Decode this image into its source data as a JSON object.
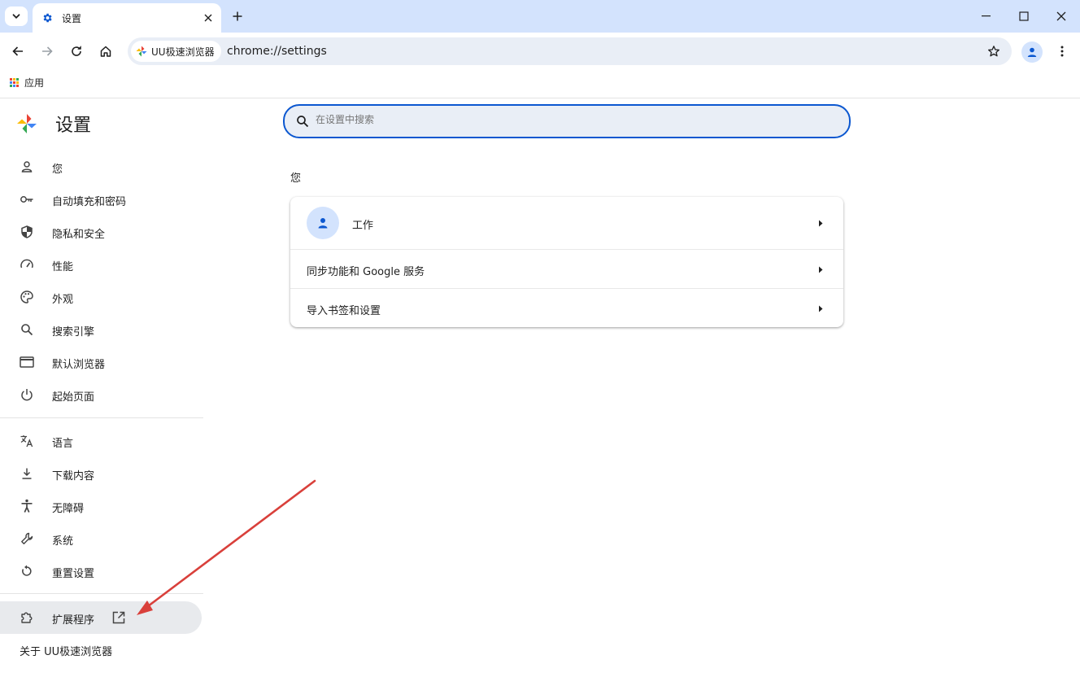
{
  "browser": {
    "tab_title": "设置",
    "chip_label": "UU极速浏览器",
    "url": "chrome://settings",
    "bookmark_apps": "应用"
  },
  "sidebar": {
    "title": "设置",
    "items": [
      {
        "label": "您",
        "icon": "person-icon"
      },
      {
        "label": "自动填充和密码",
        "icon": "key-icon"
      },
      {
        "label": "隐私和安全",
        "icon": "shield-icon"
      },
      {
        "label": "性能",
        "icon": "speedometer-icon"
      },
      {
        "label": "外观",
        "icon": "palette-icon"
      },
      {
        "label": "搜索引擎",
        "icon": "search-icon"
      },
      {
        "label": "默认浏览器",
        "icon": "browser-window-icon"
      },
      {
        "label": "起始页面",
        "icon": "power-icon"
      },
      {
        "label": "语言",
        "icon": "translate-icon"
      },
      {
        "label": "下载内容",
        "icon": "download-icon"
      },
      {
        "label": "无障碍",
        "icon": "accessibility-icon"
      },
      {
        "label": "系统",
        "icon": "wrench-icon"
      },
      {
        "label": "重置设置",
        "icon": "reset-icon"
      }
    ],
    "extensions": {
      "label": "扩展程序",
      "icon": "puzzle-icon",
      "external_icon": "open-in-new-icon"
    },
    "about": "关于 UU极速浏览器"
  },
  "main": {
    "search_placeholder": "在设置中搜索",
    "section_title": "您",
    "rows": [
      {
        "label": "工作"
      },
      {
        "label": "同步功能和 Google 服务"
      },
      {
        "label": "导入书签和设置"
      }
    ]
  },
  "colors": {
    "accent": "#0b57d0",
    "tabstrip": "#d3e3fd",
    "omnibox": "#e9eef6",
    "annotation_arrow": "#d9403b"
  }
}
